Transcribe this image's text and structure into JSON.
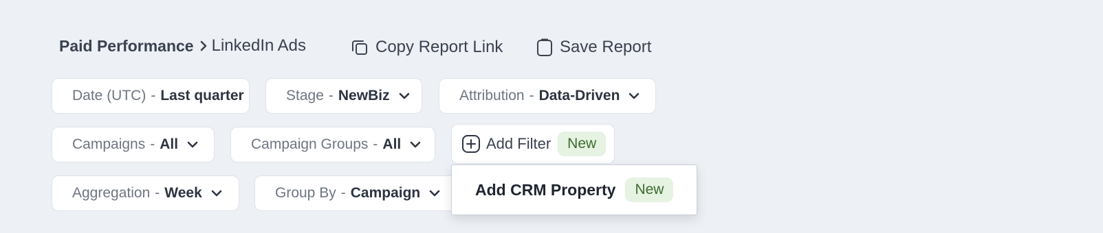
{
  "breadcrumb": {
    "parent": "Paid Performance",
    "current": "LinkedIn Ads"
  },
  "actions": {
    "copy_link": "Copy Report Link",
    "save_report": "Save Report"
  },
  "separator": "-",
  "filters": {
    "date": {
      "label": "Date (UTC)",
      "value": "Last quarter"
    },
    "stage": {
      "label": "Stage",
      "value": "NewBiz"
    },
    "attribution": {
      "label": "Attribution",
      "value": "Data-Driven"
    },
    "campaigns": {
      "label": "Campaigns",
      "value": "All"
    },
    "campaign_groups": {
      "label": "Campaign Groups",
      "value": "All"
    },
    "aggregation": {
      "label": "Aggregation",
      "value": "Week"
    },
    "group_by": {
      "label": "Group By",
      "value": "Campaign"
    }
  },
  "add_filter": {
    "label": "Add Filter",
    "badge": "New"
  },
  "dropdown": {
    "item_label": "Add CRM Property",
    "badge": "New"
  },
  "colors": {
    "background": "#edf0f4",
    "badge_bg": "#e6f2e2",
    "badge_text": "#3d6b2e"
  },
  "icons": [
    "chevron-right-icon",
    "copy-icon",
    "clipboard-icon",
    "chevron-down-icon",
    "plus-circle-icon"
  ]
}
